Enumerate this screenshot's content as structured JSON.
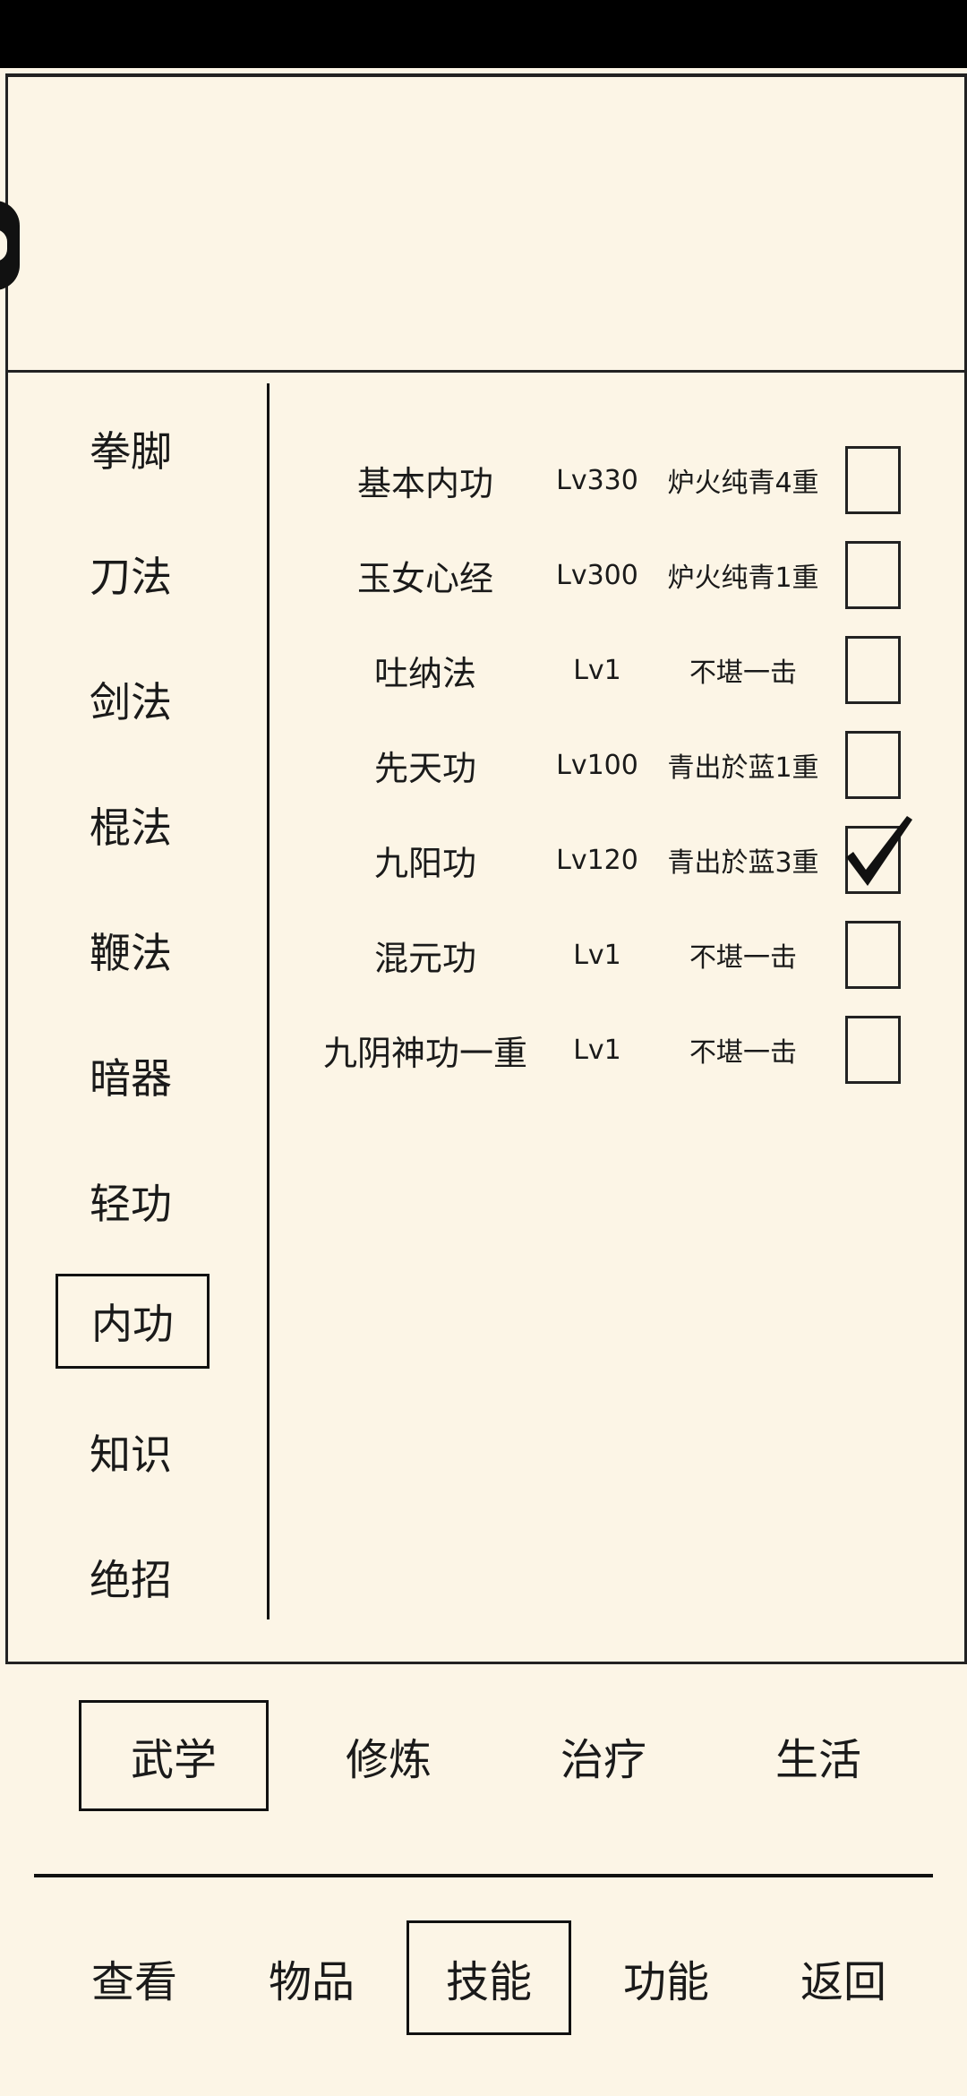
{
  "categories": [
    {
      "label": "拳脚",
      "selected": false
    },
    {
      "label": "刀法",
      "selected": false
    },
    {
      "label": "剑法",
      "selected": false
    },
    {
      "label": "棍法",
      "selected": false
    },
    {
      "label": "鞭法",
      "selected": false
    },
    {
      "label": "暗器",
      "selected": false
    },
    {
      "label": "轻功",
      "selected": false
    },
    {
      "label": "内功",
      "selected": true
    },
    {
      "label": "知识",
      "selected": false
    },
    {
      "label": "绝招",
      "selected": false
    }
  ],
  "skills": [
    {
      "name": "基本内功",
      "level": "Lv330",
      "rank": "炉火纯青4重",
      "checked": false
    },
    {
      "name": "玉女心经",
      "level": "Lv300",
      "rank": "炉火纯青1重",
      "checked": false
    },
    {
      "name": "吐纳法",
      "level": "Lv1",
      "rank": "不堪一击",
      "checked": false
    },
    {
      "name": "先天功",
      "level": "Lv100",
      "rank": "青出於蓝1重",
      "checked": false
    },
    {
      "name": "九阳功",
      "level": "Lv120",
      "rank": "青出於蓝3重",
      "checked": true
    },
    {
      "name": "混元功",
      "level": "Lv1",
      "rank": "不堪一击",
      "checked": false
    },
    {
      "name": "九阴神功一重",
      "level": "Lv1",
      "rank": "不堪一击",
      "checked": false
    }
  ],
  "sub_tabs": [
    {
      "label": "武学",
      "selected": true
    },
    {
      "label": "修炼",
      "selected": false
    },
    {
      "label": "治疗",
      "selected": false
    },
    {
      "label": "生活",
      "selected": false
    }
  ],
  "bottom_tabs": [
    {
      "label": "查看",
      "selected": false
    },
    {
      "label": "物品",
      "selected": false
    },
    {
      "label": "技能",
      "selected": true
    },
    {
      "label": "功能",
      "selected": false
    },
    {
      "label": "返回",
      "selected": false
    }
  ],
  "colors": {
    "background": "#fcf5e6",
    "ink": "#1a1a1a",
    "status_bar": "#000000"
  },
  "icons": {
    "checkbox_checked": "checkmark-icon",
    "side_handle": "side-drawer-handle-icon"
  }
}
